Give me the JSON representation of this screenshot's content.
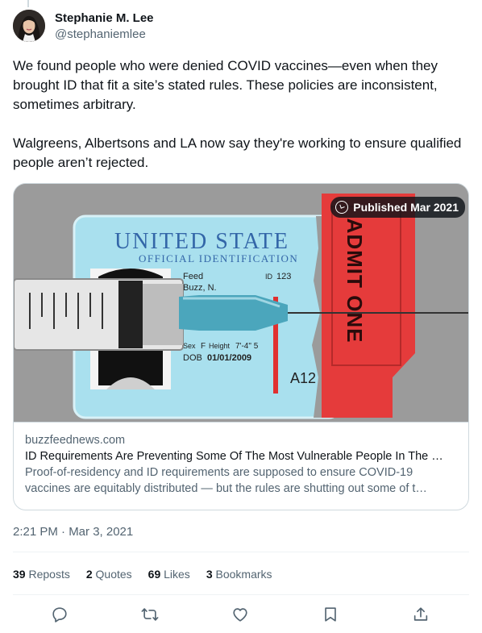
{
  "author": {
    "display_name": "Stephanie M. Lee",
    "handle": "@stephaniemlee"
  },
  "tweet": {
    "text": "We found people who were denied COVID vaccines—even when they brought ID that fit a site’s stated rules. These policies are inconsistent, sometimes arbitrary.\n\nWalgreens, Albertsons and LA now say they're working to ensure qualified people aren’t rejected."
  },
  "card": {
    "badge_label": "Published Mar 2021",
    "domain": "buzzfeednews.com",
    "title": "ID Requirements Are Preventing Some Of The Most Vulnerable People In The …",
    "description_line1": "Proof-of-residency and ID requirements are supposed to ensure COVID-19",
    "description_line2": "vaccines are equitably distributed — but the rules are shutting out some of t…",
    "image": {
      "id_card_title": "UNITED STATE",
      "id_card_subtitle": "OFFICIAL IDENTIFICATION",
      "name_last": "Feed",
      "name_first": "Buzz, N.",
      "id_label": "ID",
      "id_number": "123",
      "sex_label": "Sex",
      "sex_value": "F",
      "height_label": "Height",
      "height_value": "7'-4\" 5",
      "dob_label": "DOB",
      "dob_value": "01/01/2009",
      "code": "A12",
      "ticket_text": "ADMIT ONE"
    }
  },
  "timestamp": "2:21 PM · Mar 3, 2021",
  "stats": {
    "reposts_count": "39",
    "reposts_label": "Reposts",
    "quotes_count": "2",
    "quotes_label": "Quotes",
    "likes_count": "69",
    "likes_label": "Likes",
    "bookmarks_count": "3",
    "bookmarks_label": "Bookmarks"
  },
  "actions": {
    "reply_icon": "reply-icon",
    "repost_icon": "repost-icon",
    "like_icon": "heart-icon",
    "bookmark_icon": "bookmark-icon",
    "share_icon": "share-icon"
  },
  "colors": {
    "text_primary": "#0f1419",
    "text_secondary": "#536471",
    "border": "#cfd9de",
    "id_card_blue": "#3366a8",
    "ticket_red": "#e53b3b",
    "syringe_teal": "#4ba6bc"
  }
}
